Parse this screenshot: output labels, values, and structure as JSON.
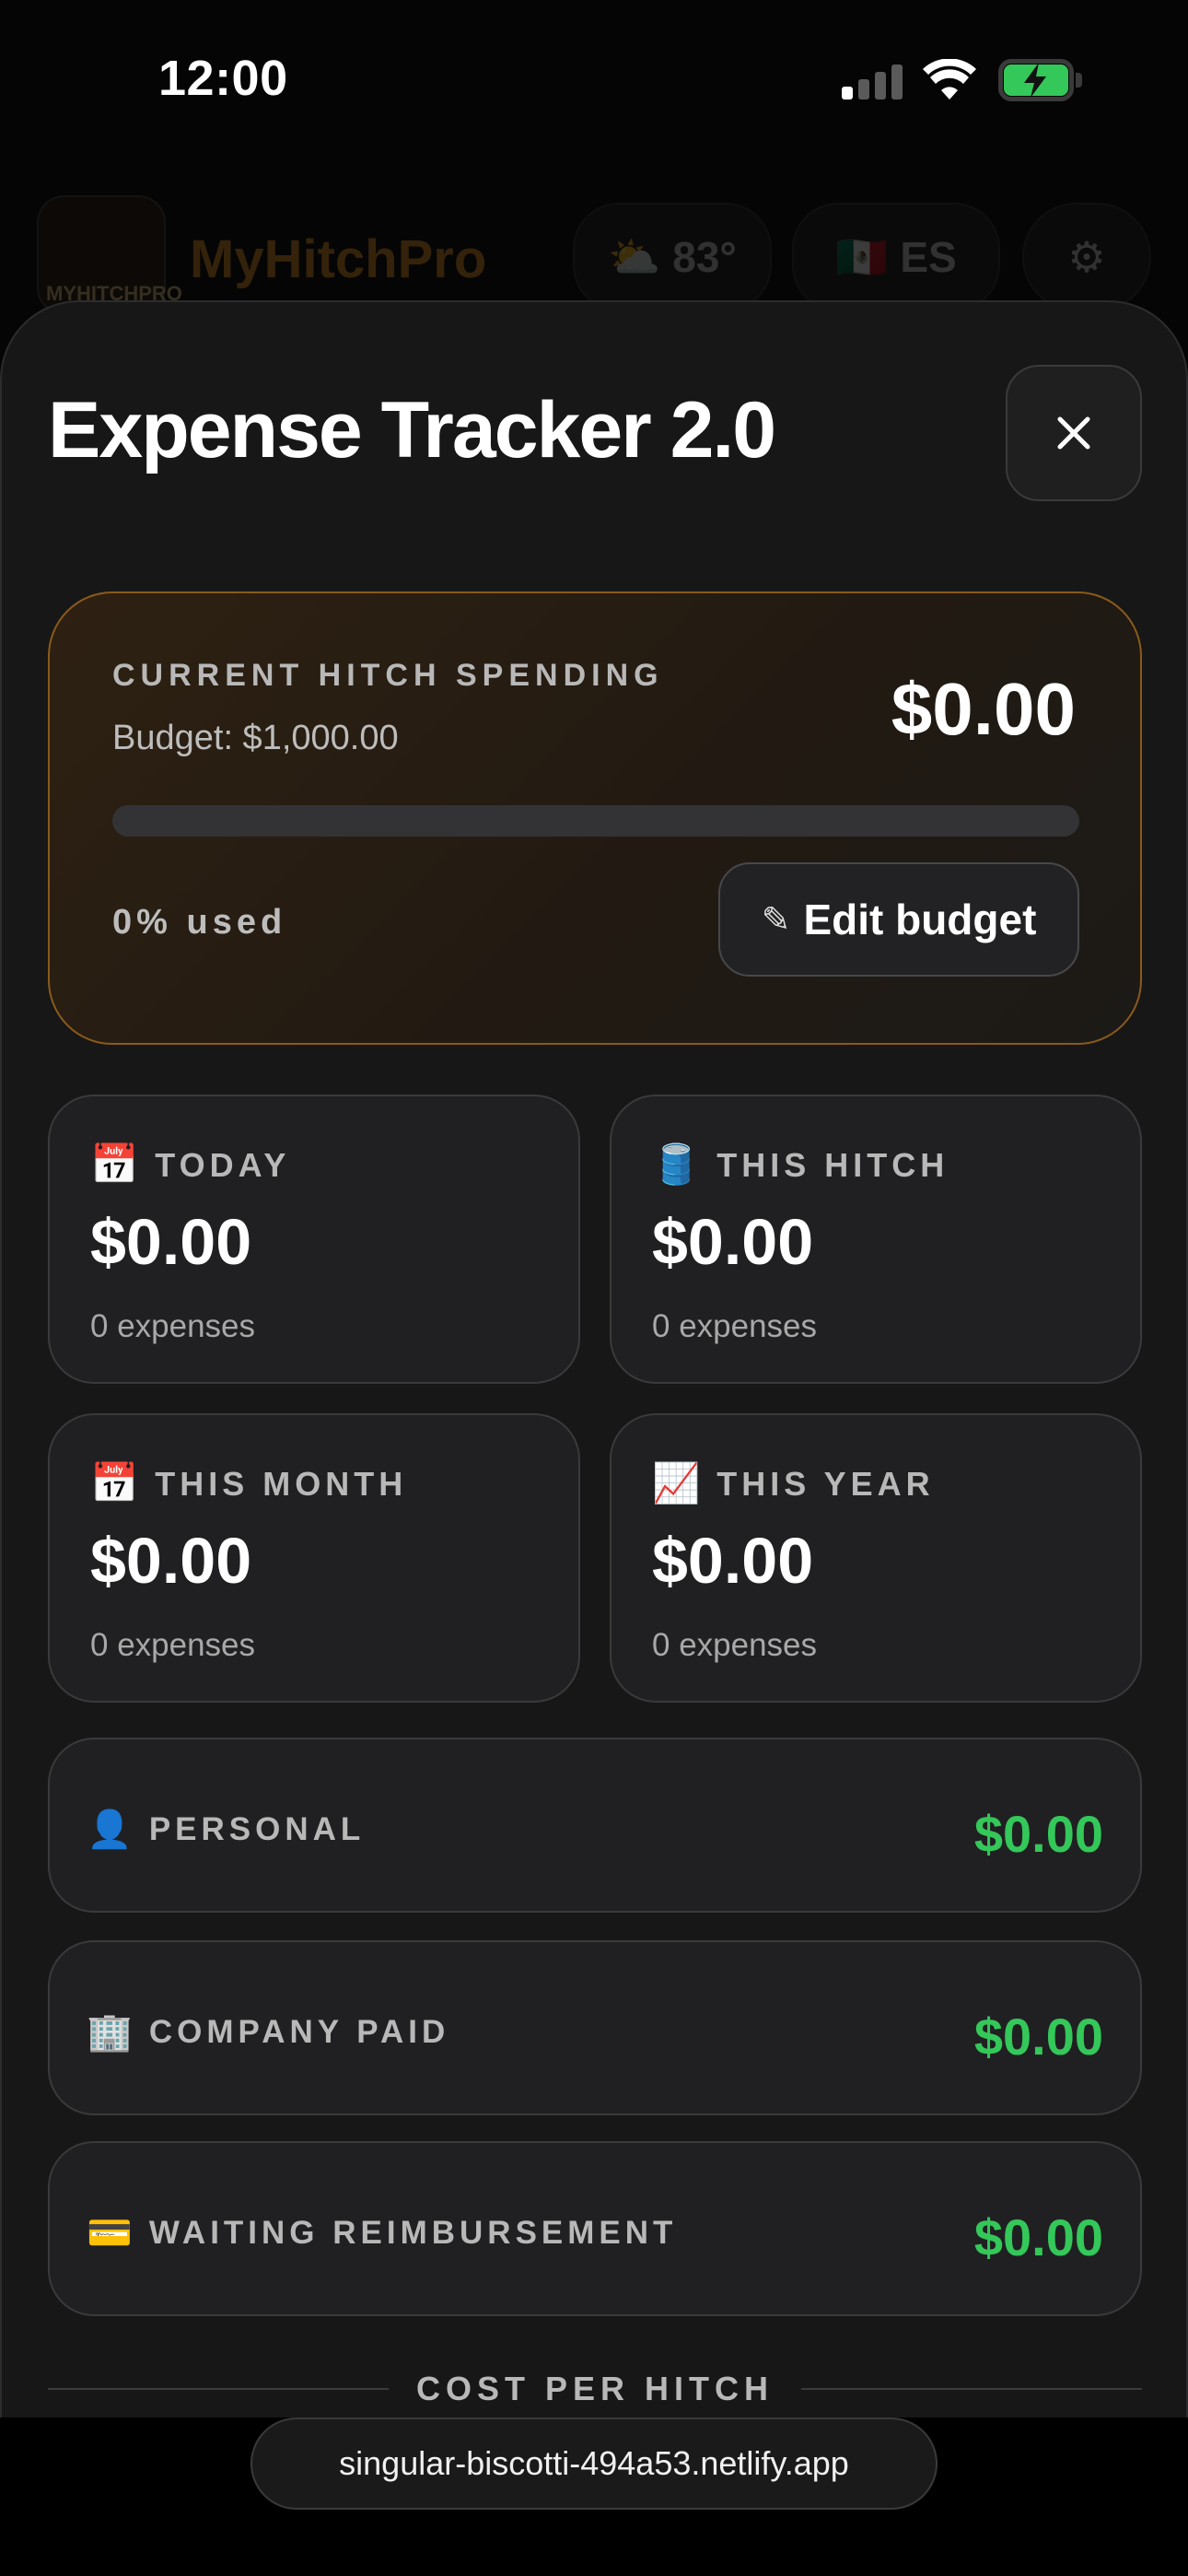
{
  "status_bar": {
    "time": "12:00",
    "icons": [
      "cellular-signal-icon",
      "wifi-icon",
      "battery-charging-icon"
    ],
    "battery_color": "#34c759"
  },
  "background_app": {
    "logo_text": "MYHITCHPRO",
    "name": "MyHitchPro",
    "weather_icon": "sun-cloud-icon",
    "weather": "83°",
    "language_flag_icon": "mexico-flag-icon",
    "language": "ES",
    "settings_icon": "gear-icon",
    "brand_color": "#d98a1c"
  },
  "modal": {
    "title": "Expense Tracker 2.0",
    "close_icon": "close-icon"
  },
  "budget": {
    "label": "CURRENT HITCH SPENDING",
    "budget_text": "Budget: $1,000.00",
    "amount": "$0.00",
    "used_fraction": 0,
    "used_text": "0% used",
    "edit_icon": "pencil-icon",
    "edit_glyph": "✎",
    "edit_label": "Edit budget"
  },
  "stats": [
    {
      "icon": "calendar-icon",
      "glyph": "📅",
      "label": "TODAY",
      "value": "$0.00",
      "count": "0 expenses"
    },
    {
      "icon": "oil-barrel-icon",
      "glyph": "🛢️",
      "label": "THIS HITCH",
      "value": "$0.00",
      "count": "0 expenses"
    },
    {
      "icon": "calendar-icon",
      "glyph": "📅",
      "label": "THIS MONTH",
      "value": "$0.00",
      "count": "0 expenses"
    },
    {
      "icon": "chart-increasing-icon",
      "glyph": "📈",
      "label": "THIS YEAR",
      "value": "$0.00",
      "count": "0 expenses"
    }
  ],
  "categories": [
    {
      "icon": "person-icon",
      "glyph": "👤",
      "label": "PERSONAL",
      "amount": "$0.00"
    },
    {
      "icon": "office-building-icon",
      "glyph": "🏢",
      "label": "COMPANY PAID",
      "amount": "$0.00"
    },
    {
      "icon": "credit-card-icon",
      "glyph": "💳",
      "label": "WAITING REIMBURSEMENT",
      "amount": "$0.00"
    }
  ],
  "accent_positive": "#34c759",
  "section": {
    "cost_per_hitch": "COST PER HITCH"
  },
  "browser": {
    "url": "singular-biscotti-494a53.netlify.app"
  }
}
